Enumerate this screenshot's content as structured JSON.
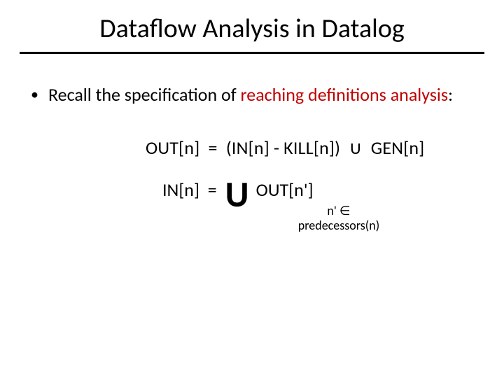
{
  "title": "Dataflow Analysis in Datalog",
  "bullet": {
    "prefix": "Recall the specification of ",
    "highlight": "reaching definitions analysis",
    "suffix": ":"
  },
  "eq1": {
    "lhs": "OUT[n]",
    "eq": "=",
    "rhs1": "(IN[n] - KILL[n])",
    "op": "∪",
    "rhs2": "GEN[n]"
  },
  "eq2": {
    "lhs": "IN[n]",
    "eq": "=",
    "bigop": "U",
    "rhs": "OUT[n']",
    "sub_line1_a": "n'",
    "sub_line1_b": "∈",
    "sub_line2": "predecessors(n)"
  }
}
